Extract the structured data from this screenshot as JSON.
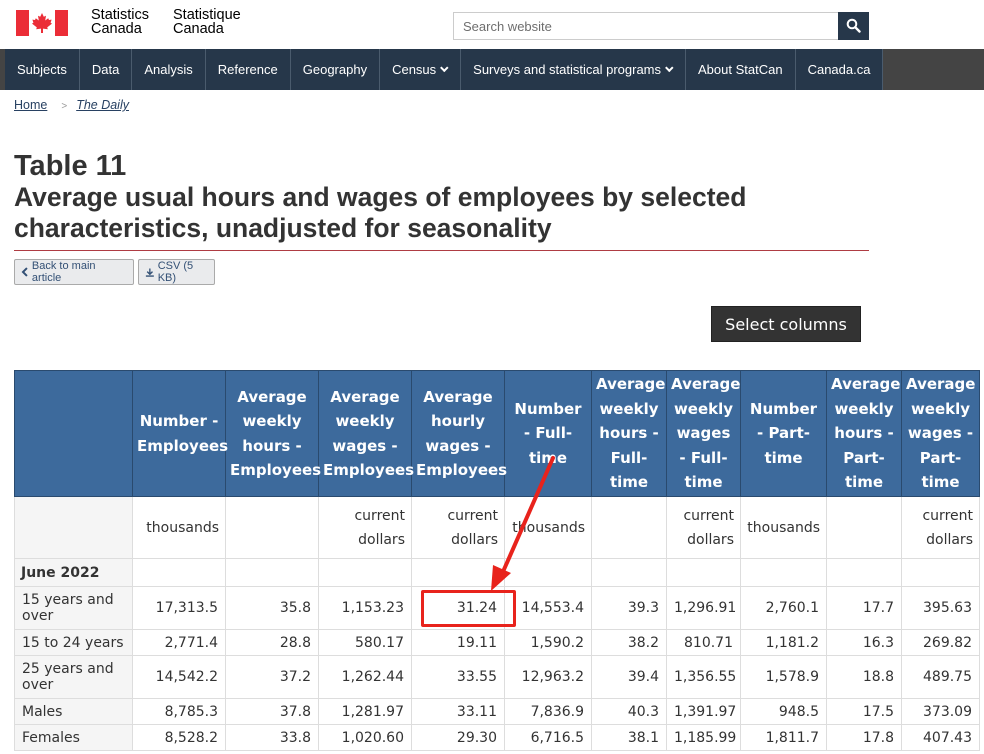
{
  "header": {
    "signature_en_1": "Statistics",
    "signature_en_2": "Canada",
    "signature_fr_1": "Statistique",
    "signature_fr_2": "Canada",
    "search_placeholder": "Search website"
  },
  "menu": {
    "items": [
      {
        "label": "Subjects",
        "dropdown": false
      },
      {
        "label": "Data",
        "dropdown": false
      },
      {
        "label": "Analysis",
        "dropdown": false
      },
      {
        "label": "Reference",
        "dropdown": false
      },
      {
        "label": "Geography",
        "dropdown": false
      },
      {
        "label": "Census",
        "dropdown": true
      },
      {
        "label": "Surveys and statistical programs",
        "dropdown": true
      },
      {
        "label": "About StatCan",
        "dropdown": false
      },
      {
        "label": "Canada.ca",
        "dropdown": false
      }
    ]
  },
  "breadcrumb": {
    "home": "Home",
    "separator": ">",
    "current": "The Daily"
  },
  "page": {
    "table_label": "Table 11",
    "table_title": "Average usual hours and wages of employees by selected characteristics, unadjusted for seasonality",
    "back_button": "Back to main article",
    "csv_button": "CSV (5 KB)",
    "select_columns": "Select columns"
  },
  "table": {
    "headers": [
      "",
      "Number - Employees",
      "Average weekly hours - Employees",
      "Average weekly wages - Employees",
      "Average hourly wages - Employees",
      "Number - Full-time",
      "Average weekly hours - Full-time",
      "Average weekly wages - Full-time",
      "Number - Part-time",
      "Average weekly hours - Part-time",
      "Average weekly wages - Part-time"
    ],
    "units": [
      "",
      "thousands",
      "",
      "current dollars",
      "current dollars",
      "thousands",
      "",
      "current dollars",
      "thousands",
      "",
      "current dollars"
    ],
    "section": "June 2022",
    "rows": [
      {
        "label": "15 years and over",
        "values": [
          "17,313.5",
          "35.8",
          "1,153.23",
          "31.24",
          "14,553.4",
          "39.3",
          "1,296.91",
          "2,760.1",
          "17.7",
          "395.63"
        ]
      },
      {
        "label": "15 to 24 years",
        "values": [
          "2,771.4",
          "28.8",
          "580.17",
          "19.11",
          "1,590.2",
          "38.2",
          "810.71",
          "1,181.2",
          "16.3",
          "269.82"
        ]
      },
      {
        "label": "25 years and over",
        "values": [
          "14,542.2",
          "37.2",
          "1,262.44",
          "33.55",
          "12,963.2",
          "39.4",
          "1,356.55",
          "1,578.9",
          "18.8",
          "489.75"
        ]
      },
      {
        "label": "Males",
        "values": [
          "8,785.3",
          "37.8",
          "1,281.97",
          "33.11",
          "7,836.9",
          "40.3",
          "1,391.97",
          "948.5",
          "17.5",
          "373.09"
        ]
      },
      {
        "label": "Females",
        "values": [
          "8,528.2",
          "33.8",
          "1,020.60",
          "29.30",
          "6,716.5",
          "38.1",
          "1,185.99",
          "1,811.7",
          "17.8",
          "407.43"
        ]
      }
    ]
  },
  "colors": {
    "nav_bg": "#26374a",
    "table_header_bg": "#3d6a9c",
    "accent_red": "#af3c43",
    "annotation_red": "#e8231c"
  }
}
